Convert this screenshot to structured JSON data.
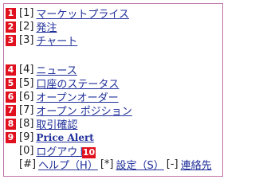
{
  "items": [
    {
      "badge": "1",
      "key": "[1]",
      "label": "マーケットプライス"
    },
    {
      "badge": "2",
      "key": "[2]",
      "label": "発注"
    },
    {
      "badge": "3",
      "key": "[3]",
      "label": "チャート"
    },
    {
      "badge": "4",
      "key": "[4]",
      "label": "ニュース"
    },
    {
      "badge": "5",
      "key": "[5]",
      "label": "口座のステータス"
    },
    {
      "badge": "6",
      "key": "[6]",
      "label": "オープンオーダー"
    },
    {
      "badge": "7",
      "key": "[7]",
      "label": "オープン ポジション"
    },
    {
      "badge": "8",
      "key": "[8]",
      "label": "取引確認"
    },
    {
      "badge": "9",
      "key": "[9]",
      "label": "Price Alert"
    },
    {
      "badge": "",
      "key": "[0]",
      "label": "ログアウト"
    }
  ],
  "footer": {
    "help_key": "[#]",
    "help_label": "ヘルプ（H）",
    "settings_key": "[*]",
    "settings_label": "設定（S）",
    "contact_key": "[-]",
    "contact_label": "連絡先",
    "badge": "10"
  },
  "colors": {
    "badge": "#e0101e",
    "link": "#1f2f9a",
    "frame": "#c070a8"
  }
}
